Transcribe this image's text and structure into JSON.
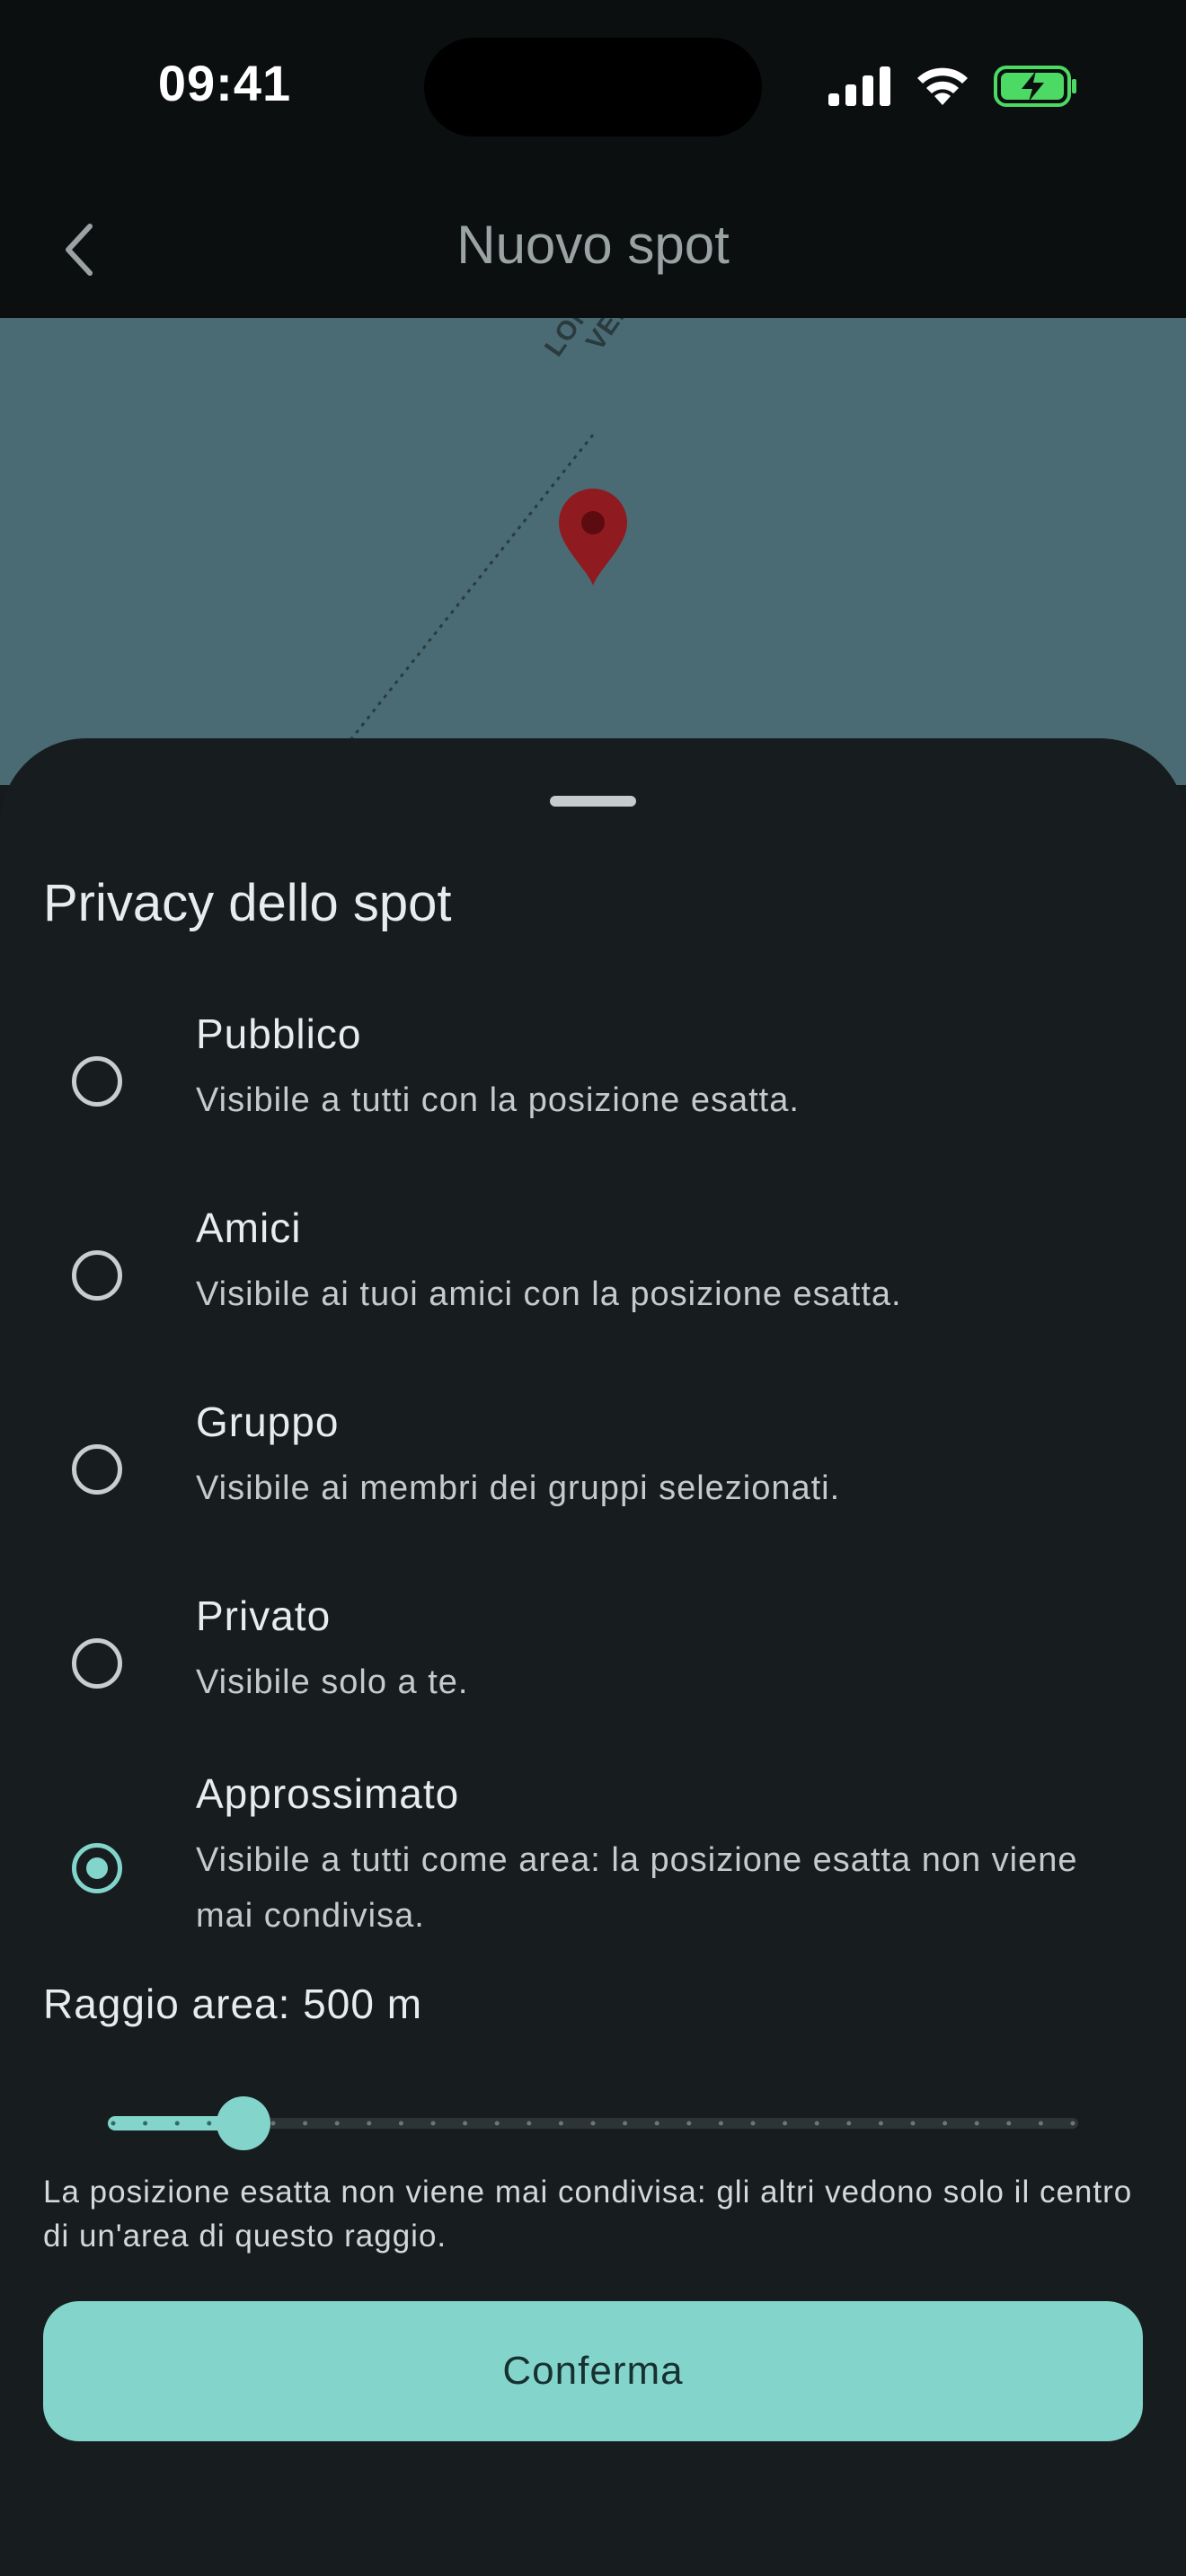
{
  "status_bar": {
    "time": "09:41",
    "icons": [
      "cellular-signal-icon",
      "wifi-icon",
      "battery-charging-icon"
    ]
  },
  "app_bar": {
    "title": "Nuovo spot",
    "back_icon": "chevron-left-icon"
  },
  "map": {
    "border_label_line1": "LOMBARDIA",
    "border_label_line2": "VENETO",
    "pin_icon": "map-pin-icon",
    "pin_color": "#8f1a1f"
  },
  "sheet": {
    "title": "Privacy dello spot",
    "options": [
      {
        "label": "Pubblico",
        "description": "Visibile a tutti con la posizione esatta.",
        "selected": false
      },
      {
        "label": "Amici",
        "description": "Visibile ai tuoi amici con la posizione esatta.",
        "selected": false
      },
      {
        "label": "Gruppo",
        "description": "Visibile ai membri dei gruppi selezionati.",
        "selected": false
      },
      {
        "label": "Privato",
        "description": "Visibile solo a te.",
        "selected": false
      },
      {
        "label": "Approssimato",
        "description": "Visibile a tutti come area: la posizione esatta non viene mai condivisa.",
        "selected": true
      }
    ],
    "radius_label": "Raggio area: 500 m",
    "slider": {
      "value_fraction": 0.14,
      "steps": 30
    },
    "note": "La posizione esatta non viene mai condivisa: gli altri vedono solo il centro di un'area di questo raggio.",
    "confirm_label": "Conferma"
  },
  "colors": {
    "accent": "#83d5cc",
    "background": "#171d1e",
    "map": "#4a6b73"
  }
}
